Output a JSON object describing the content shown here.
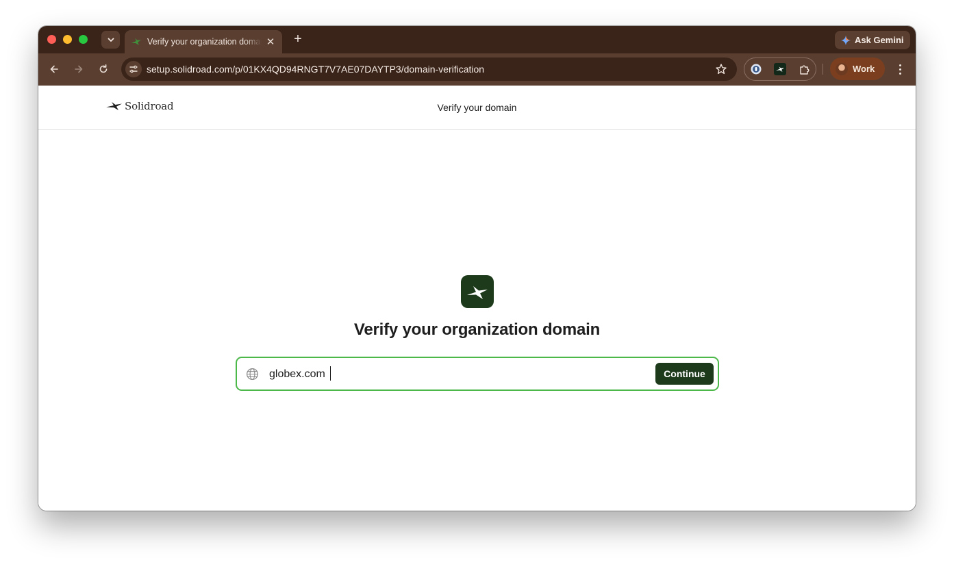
{
  "browser": {
    "tab": {
      "title": "Verify your organization domain",
      "close_glyph": "✕"
    },
    "new_tab_glyph": "+",
    "gemini_label": "Ask Gemini",
    "url": "setup.solidroad.com/p/01KX4QD94RNGT7V7AE07DAYTP3/domain-verification",
    "profile_label": "Work"
  },
  "site": {
    "brand": "Solidroad",
    "header_title": "Verify your domain"
  },
  "main": {
    "headline": "Verify your organization domain",
    "domain_input": {
      "value": "globex.com"
    },
    "continue_label": "Continue"
  },
  "colors": {
    "chrome_dark": "#3a2419",
    "chrome_toolbar": "#5a3f31",
    "brand_green": "#1d3a1b",
    "focus_green": "#4cb84a",
    "profile_bg": "#7b3f1f"
  }
}
